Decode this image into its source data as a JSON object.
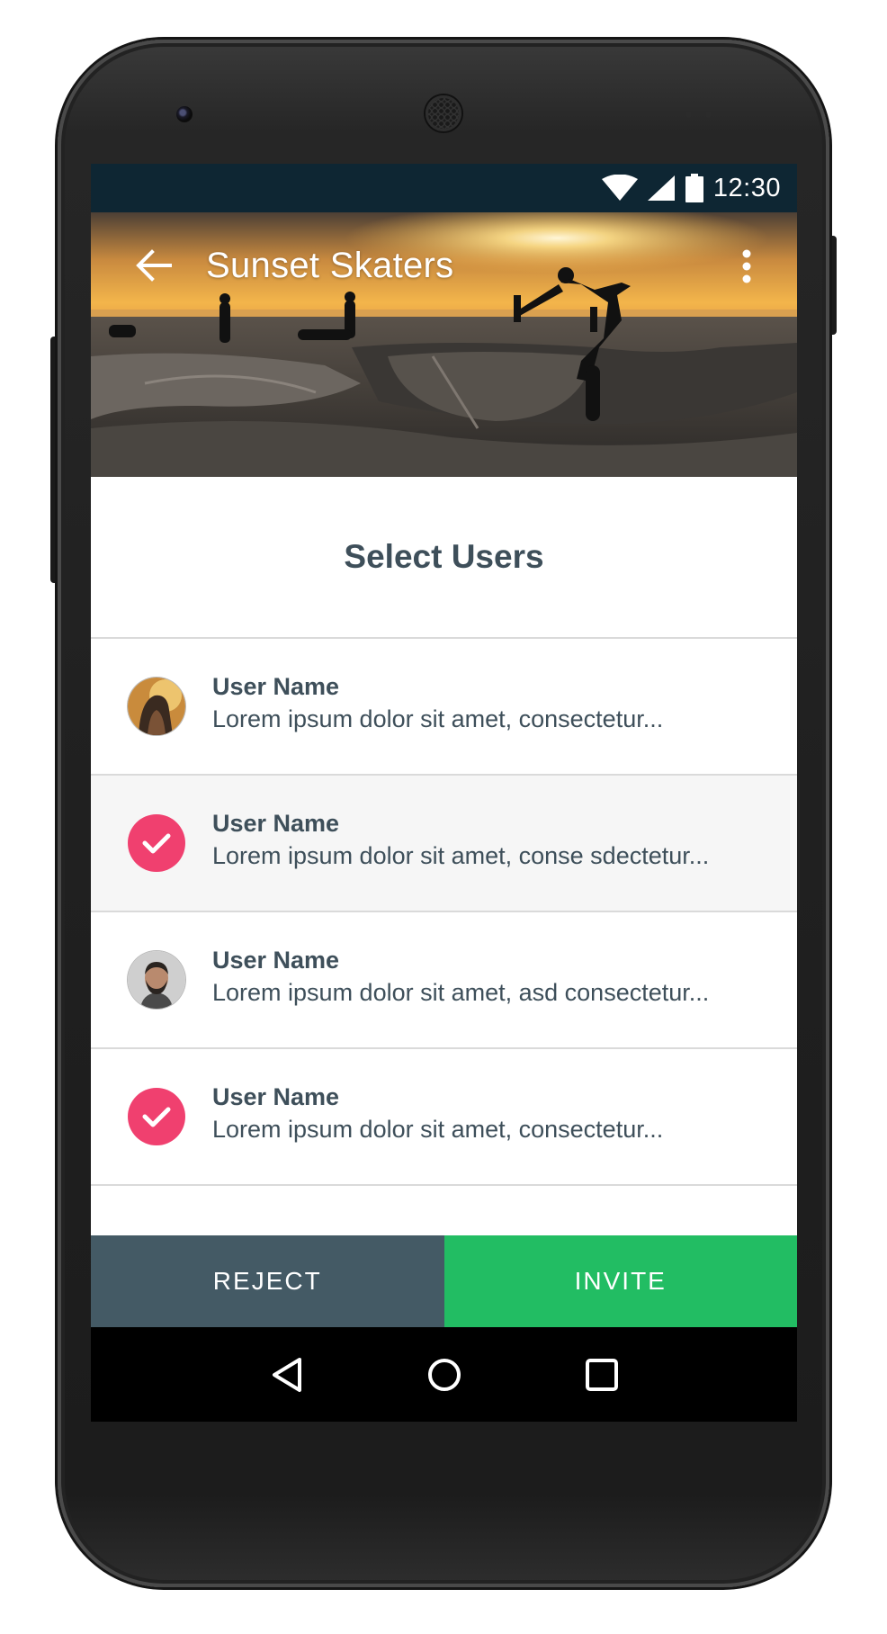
{
  "status_bar": {
    "time": "12:30",
    "icons": [
      "wifi-icon",
      "signal-icon",
      "battery-icon"
    ]
  },
  "toolbar": {
    "title": "Sunset Skaters",
    "back_icon": "arrow-back-icon",
    "menu_icon": "more-vert-icon"
  },
  "section": {
    "title": "Select Users"
  },
  "users": [
    {
      "name": "User Name",
      "description": "Lorem ipsum dolor sit amet, consectetur...",
      "selected": false,
      "avatar": "woman-avatar"
    },
    {
      "name": "User Name",
      "description": "Lorem ipsum dolor sit amet, conse sdectetur...",
      "selected": true,
      "avatar": "check-icon"
    },
    {
      "name": "User Name",
      "description": "Lorem ipsum dolor sit amet, asd consectetur...",
      "selected": false,
      "avatar": "man-avatar"
    },
    {
      "name": "User Name",
      "description": "Lorem ipsum dolor sit amet, consectetur...",
      "selected": true,
      "avatar": "check-icon"
    }
  ],
  "actions": {
    "reject_label": "REJECT",
    "invite_label": "INVITE"
  },
  "nav": {
    "icons": [
      "back-triangle-icon",
      "home-circle-icon",
      "recents-square-icon"
    ]
  },
  "colors": {
    "status_bar": "#0e2633",
    "accent_pink": "#f0406f",
    "reject": "#445a65",
    "invite": "#22bd63",
    "text": "#3e4f5a"
  }
}
